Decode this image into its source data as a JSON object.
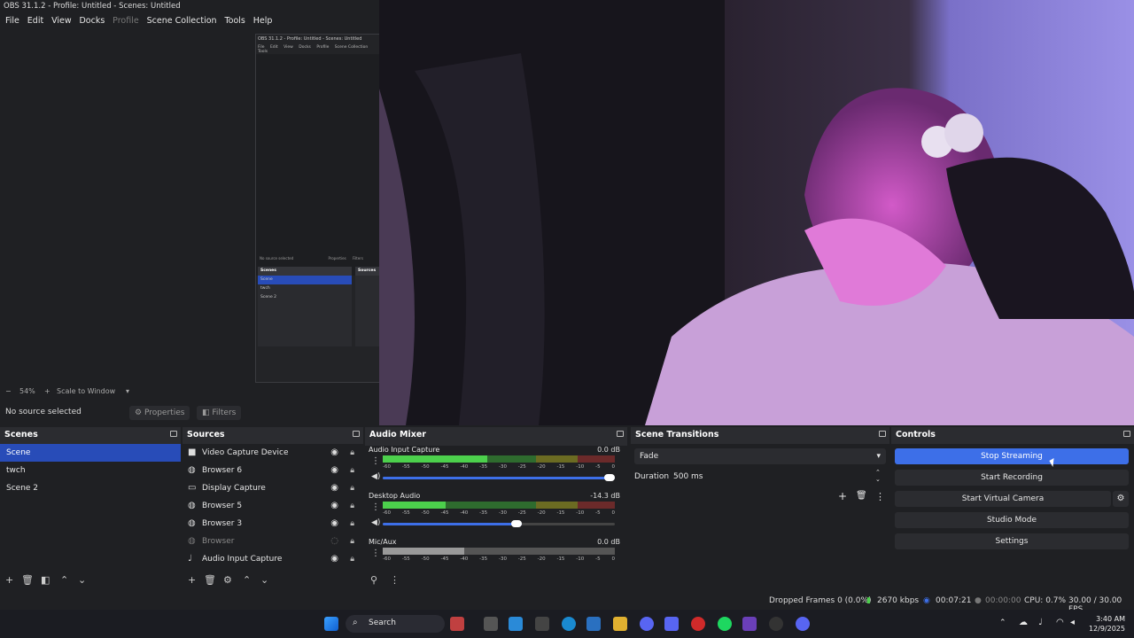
{
  "window": {
    "title": "OBS 31.1.2 - Profile: Untitled - Scenes: Untitled"
  },
  "menu": [
    "File",
    "Edit",
    "View",
    "Docks",
    "Profile",
    "Scene Collection",
    "Tools",
    "Help"
  ],
  "mini_obs": {
    "title": "OBS 31.1.2 - Profile: Untitled - Scenes: Untitled",
    "menu": [
      "File",
      "Edit",
      "View",
      "Docks",
      "Profile",
      "Scene Collection",
      "Tools"
    ],
    "no_source": "No source selected",
    "properties": "Properties",
    "filters": "Filters",
    "scenes_label": "Scenes",
    "sources_label": "Sources",
    "scenes": [
      "Scene",
      "twch",
      "Scene 2"
    ]
  },
  "preview": {
    "zoom": "54%",
    "scale_mode": "Scale to Window"
  },
  "source_bar": {
    "no_source": "No source selected",
    "properties": "Properties",
    "filters": "Filters"
  },
  "scenes": {
    "title": "Scenes",
    "items": [
      "Scene",
      "twch",
      "Scene 2"
    ],
    "selected": 0
  },
  "sources": {
    "title": "Sources",
    "items": [
      {
        "name": "Video Capture Device",
        "icon": "camera-icon",
        "visible": true
      },
      {
        "name": "Browser 6",
        "icon": "globe-icon",
        "visible": true
      },
      {
        "name": "Display Capture",
        "icon": "monitor-icon",
        "visible": true
      },
      {
        "name": "Browser 5",
        "icon": "globe-icon",
        "visible": true
      },
      {
        "name": "Browser 3",
        "icon": "globe-icon",
        "visible": true
      },
      {
        "name": "Browser",
        "icon": "globe-icon",
        "visible": false
      },
      {
        "name": "Audio Input Capture",
        "icon": "mic-icon",
        "visible": true
      }
    ]
  },
  "mixer": {
    "title": "Audio Mixer",
    "ticks": [
      "-60",
      "-55",
      "-50",
      "-45",
      "-40",
      "-35",
      "-30",
      "-25",
      "-20",
      "-15",
      "-10",
      "-5",
      "0"
    ],
    "channels": [
      {
        "name": "Audio Input Capture",
        "db": "0.0 dB",
        "level": 0.45,
        "volume": 1.0
      },
      {
        "name": "Desktop Audio",
        "db": "-14.3 dB",
        "level": 0.27,
        "volume": 0.6
      },
      {
        "name": "Mic/Aux",
        "db": "0.0 dB",
        "level": 0.35,
        "volume": 1.0
      }
    ]
  },
  "transitions": {
    "title": "Scene Transitions",
    "selected": "Fade",
    "duration_label": "Duration",
    "duration_value": "500 ms"
  },
  "controls": {
    "title": "Controls",
    "buttons": [
      "Stop Streaming",
      "Start Recording",
      "Start Virtual Camera",
      "Studio Mode",
      "Settings"
    ]
  },
  "status": {
    "dropped": "Dropped Frames 0 (0.0%)",
    "bitrate": "2670 kbps",
    "stream_time": "00:07:21",
    "rec_time": "00:00:00",
    "cpu": "CPU: 0.7%",
    "fps": "30.00 / 30.00 FPS"
  },
  "taskbar": {
    "search": "Search",
    "time": "3:40 AM",
    "date": "12/9/2025"
  },
  "colors": {
    "accent": "#3d6fe8",
    "selected": "#284cb8",
    "panel": "#2b2c30",
    "bg": "#1f2023"
  }
}
